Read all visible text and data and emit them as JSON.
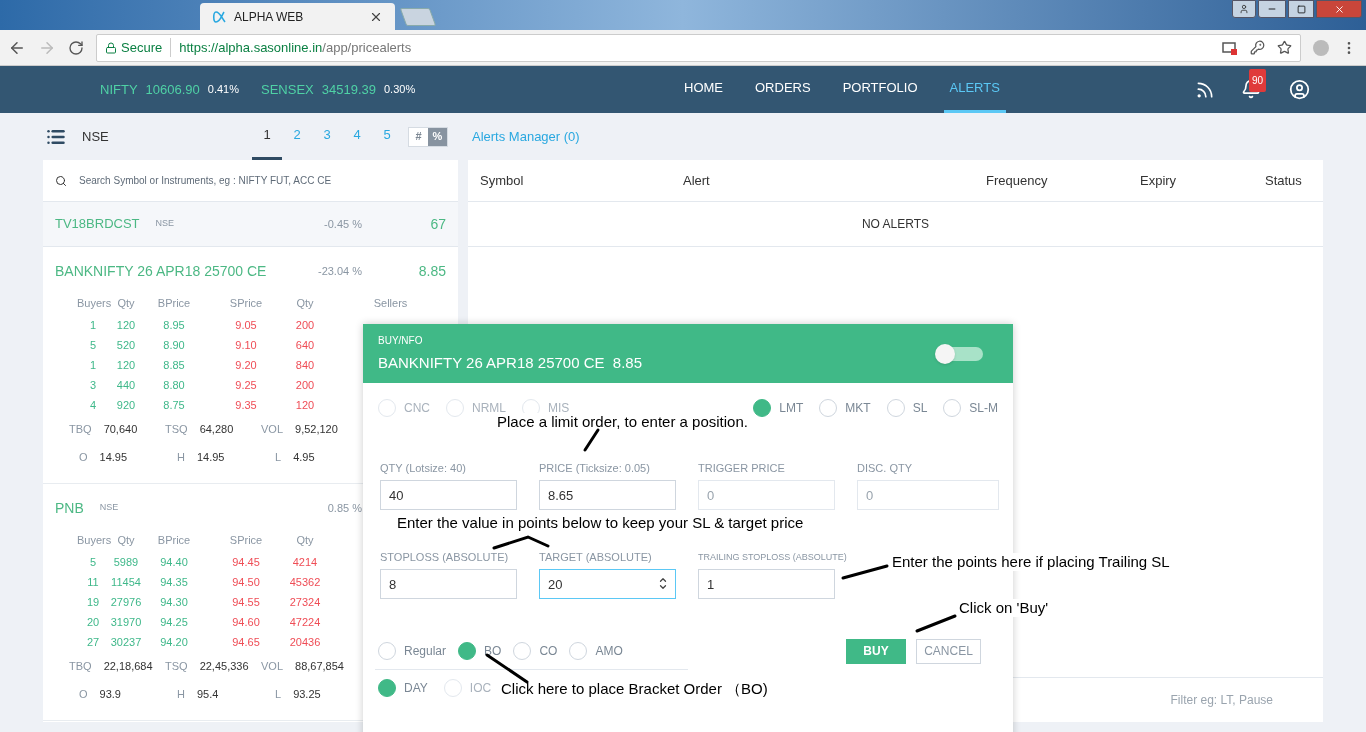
{
  "browser": {
    "tab_title": "ALPHA WEB",
    "secure_label": "Secure",
    "url_host": "https://alpha.sasonline.in",
    "url_path": "/app/pricealerts"
  },
  "header": {
    "indices": [
      {
        "name": "NIFTY",
        "value": "10606.90",
        "change": "0.41%"
      },
      {
        "name": "SENSEX",
        "value": "34519.39",
        "change": "0.30%"
      }
    ],
    "nav": [
      {
        "label": "HOME",
        "selected": false
      },
      {
        "label": "ORDERS",
        "selected": false
      },
      {
        "label": "PORTFOLIO",
        "selected": false
      },
      {
        "label": "ALERTS",
        "selected": true
      }
    ],
    "notification_count": "90"
  },
  "toolbar": {
    "exchange": "NSE",
    "pages": [
      {
        "label": "1",
        "selected": true
      },
      {
        "label": "2",
        "selected": false
      },
      {
        "label": "3",
        "selected": false
      },
      {
        "label": "4",
        "selected": false
      },
      {
        "label": "5",
        "selected": false
      }
    ],
    "modes": [
      {
        "label": "#",
        "selected": false
      },
      {
        "label": "%",
        "selected": true
      }
    ],
    "alerts_manager": "Alerts Manager (0)"
  },
  "watchlist": {
    "search_placeholder": "Search Symbol or Instruments, eg : NIFTY FUT, ACC CE",
    "items": [
      {
        "kind": "row",
        "symbol": "TV18BRDCST",
        "exchange": "NSE",
        "change": "-0.45 %",
        "price": "67"
      },
      {
        "kind": "depth",
        "symbol": "BANKNIFTY 26 APR18 25700 CE",
        "change": "-23.04 %",
        "price": "8.85",
        "columns": [
          "Buyers",
          "Qty",
          "BPrice",
          "SPrice",
          "Qty",
          "Sellers"
        ],
        "rows": [
          [
            "1",
            "120",
            "8.95",
            "9.05",
            "200"
          ],
          [
            "5",
            "520",
            "8.90",
            "9.10",
            "640"
          ],
          [
            "1",
            "120",
            "8.85",
            "9.20",
            "840"
          ],
          [
            "3",
            "440",
            "8.80",
            "9.25",
            "200"
          ],
          [
            "4",
            "920",
            "8.75",
            "9.35",
            "120"
          ]
        ],
        "totals": [
          {
            "label": "TBQ",
            "value": "70,640"
          },
          {
            "label": "TSQ",
            "value": "64,280"
          },
          {
            "label": "VOL",
            "value": "9,52,120"
          }
        ],
        "ohlc": [
          {
            "label": "O",
            "value": "14.95"
          },
          {
            "label": "H",
            "value": "14.95"
          },
          {
            "label": "L",
            "value": "4.95"
          }
        ]
      },
      {
        "kind": "depth",
        "symbol": "PNB",
        "exchange": "NSE",
        "change": "0.85 %",
        "columns": [
          "Buyers",
          "Qty",
          "BPrice",
          "SPrice",
          "Qty"
        ],
        "rows": [
          [
            "5",
            "5989",
            "94.40",
            "94.45",
            "4214"
          ],
          [
            "11",
            "11454",
            "94.35",
            "94.50",
            "45362"
          ],
          [
            "19",
            "27976",
            "94.30",
            "94.55",
            "27324"
          ],
          [
            "20",
            "31970",
            "94.25",
            "94.60",
            "47224"
          ],
          [
            "27",
            "30237",
            "94.20",
            "94.65",
            "20436"
          ]
        ],
        "totals": [
          {
            "label": "TBQ",
            "value": "22,18,684"
          },
          {
            "label": "TSQ",
            "value": "22,45,336"
          },
          {
            "label": "VOL",
            "value": "88,67,854"
          }
        ],
        "ohlc": [
          {
            "label": "O",
            "value": "93.9"
          },
          {
            "label": "H",
            "value": "95.4"
          },
          {
            "label": "L",
            "value": "93.25"
          }
        ]
      }
    ]
  },
  "alerts": {
    "columns": [
      "Symbol",
      "Alert",
      "Frequency",
      "Expiry",
      "Status"
    ],
    "empty_message": "NO ALERTS",
    "filter_placeholder": "Filter eg: LT, Pause"
  },
  "order": {
    "category": "BUY/NFO",
    "title": "BANKNIFTY 26 APR18 25700 CE  8.85",
    "toggle_on": false,
    "products": [
      {
        "label": "CNC",
        "selected": false,
        "disabled": true
      },
      {
        "label": "NRML",
        "selected": false,
        "disabled": true
      },
      {
        "label": "MIS",
        "selected": false,
        "disabled": true
      }
    ],
    "order_types": [
      {
        "label": "LMT",
        "selected": true,
        "disabled": false
      },
      {
        "label": "MKT",
        "selected": false,
        "disabled": false
      },
      {
        "label": "SL",
        "selected": false,
        "disabled": false
      },
      {
        "label": "SL-M",
        "selected": false,
        "disabled": false
      }
    ],
    "fields": [
      {
        "label": "QTY (Lotsize: 40)",
        "value": "40",
        "disabled": false,
        "focused": false
      },
      {
        "label": "PRICE (Ticksize: 0.05)",
        "value": "8.65",
        "disabled": false,
        "focused": false
      },
      {
        "label": "TRIGGER PRICE",
        "placeholder": "0",
        "disabled": true,
        "focused": false
      },
      {
        "label": "DISC. QTY",
        "placeholder": "0",
        "disabled": true,
        "focused": false
      },
      {
        "label": "STOPLOSS (ABSOLUTE)",
        "value": "8",
        "disabled": false,
        "focused": false
      },
      {
        "label": "TARGET (ABSOLUTE)",
        "value": "20",
        "disabled": false,
        "focused": true
      },
      {
        "label": "TRAILING STOPLOSS (ABSOLUTE)",
        "value": "1",
        "disabled": false,
        "focused": false
      }
    ],
    "varieties": [
      {
        "label": "Regular",
        "selected": false,
        "disabled": false
      },
      {
        "label": "BO",
        "selected": true,
        "disabled": false
      },
      {
        "label": "CO",
        "selected": false,
        "disabled": false
      },
      {
        "label": "AMO",
        "selected": false,
        "disabled": false
      }
    ],
    "validity": [
      {
        "label": "DAY",
        "selected": true,
        "disabled": false
      },
      {
        "label": "IOC",
        "selected": false,
        "disabled": true
      }
    ],
    "buttons": [
      {
        "kind": "primary",
        "label": "BUY"
      },
      {
        "kind": "secondary",
        "label": "CANCEL"
      }
    ]
  },
  "annotations": [
    {
      "text": "Place a limit order, to enter a position."
    },
    {
      "text": "Enter the value in points below to keep your SL & target price"
    },
    {
      "text": "Enter the points here if placing Trailing SL"
    },
    {
      "text": "Click on 'Buy'"
    },
    {
      "text": "Click here to place Bracket Order （BO)"
    }
  ]
}
